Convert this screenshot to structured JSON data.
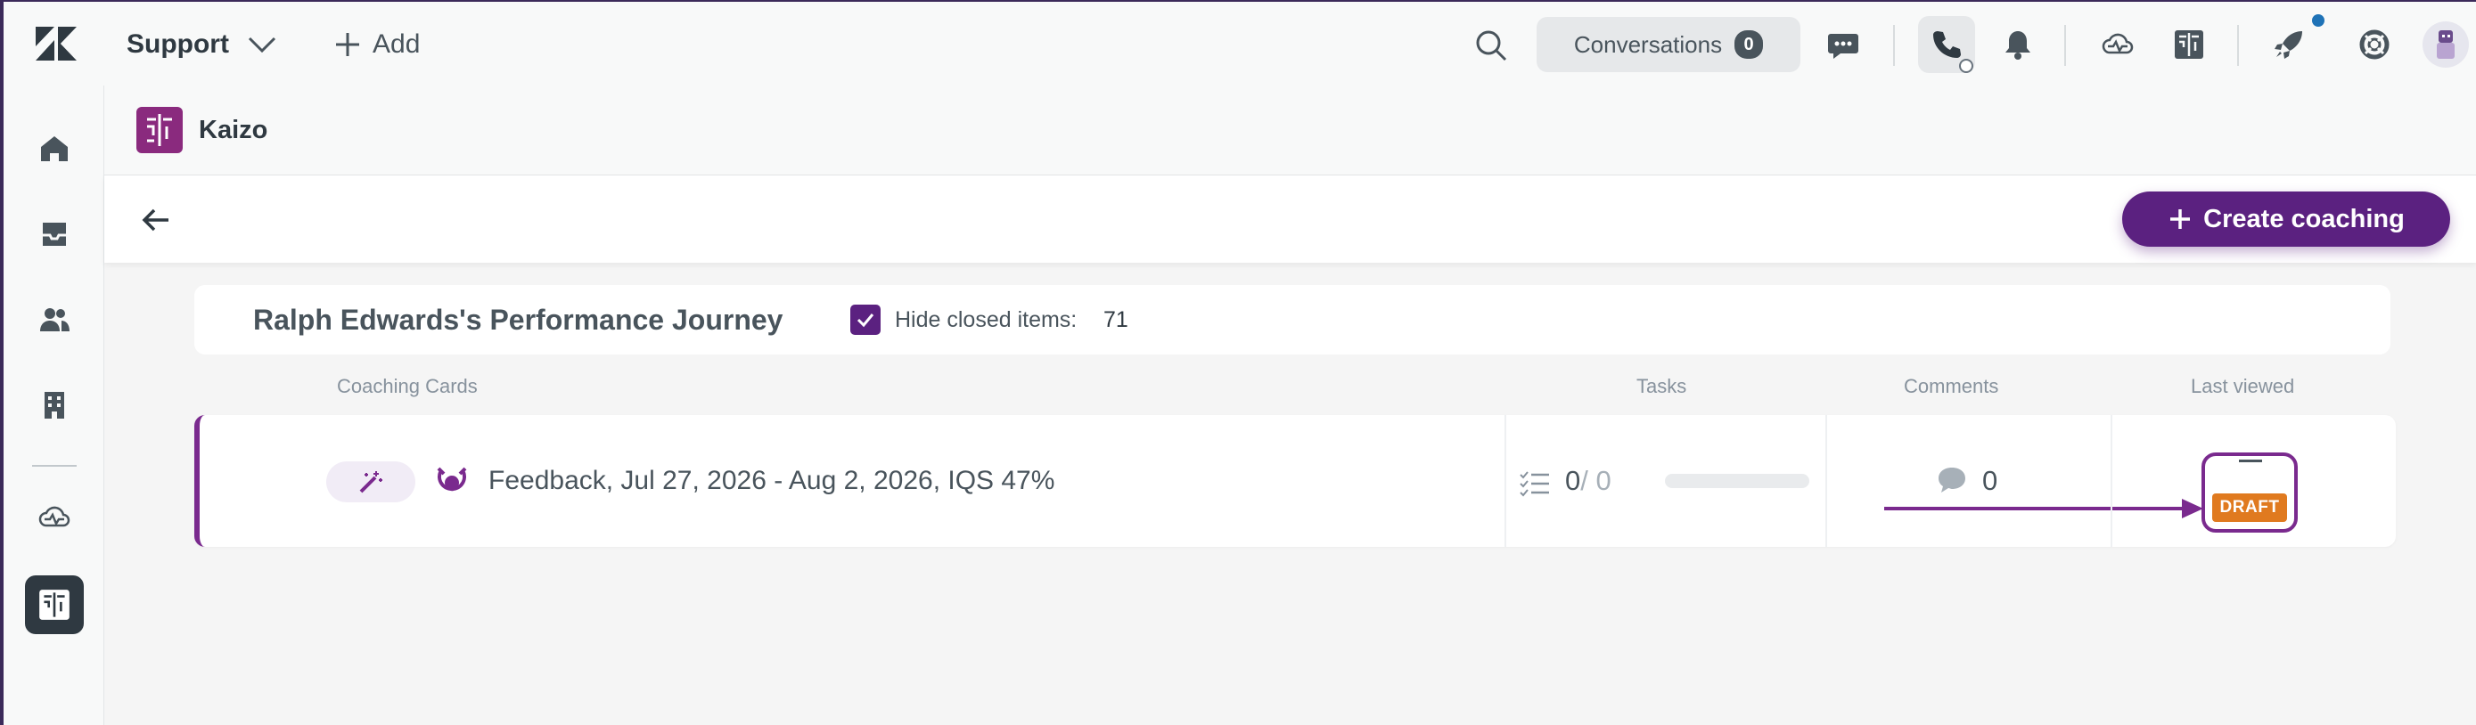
{
  "topbar": {
    "product": "Support",
    "add_label": "Add",
    "conversations_label": "Conversations",
    "conversations_count": "0"
  },
  "app": {
    "name": "Kaizo"
  },
  "toolbar": {
    "create_label": "Create coaching"
  },
  "journey": {
    "title": "Ralph Edwards's Performance Journey",
    "hide_label": "Hide closed items:",
    "hide_checked": true,
    "hidden_count": "71"
  },
  "columns": {
    "cards": "Coaching Cards",
    "tasks": "Tasks",
    "comments": "Comments",
    "last_viewed": "Last viewed"
  },
  "card": {
    "title": "Feedback, Jul 27, 2026 - Aug 2, 2026, IQS 47%",
    "tasks_done": "0",
    "tasks_total": "/ 0",
    "tasks_progress": 0,
    "comments": "0",
    "status_badge": "DRAFT"
  },
  "colors": {
    "accent": "#5b2180",
    "card_border": "#7a2a8e",
    "draft": "#e07a1f"
  }
}
